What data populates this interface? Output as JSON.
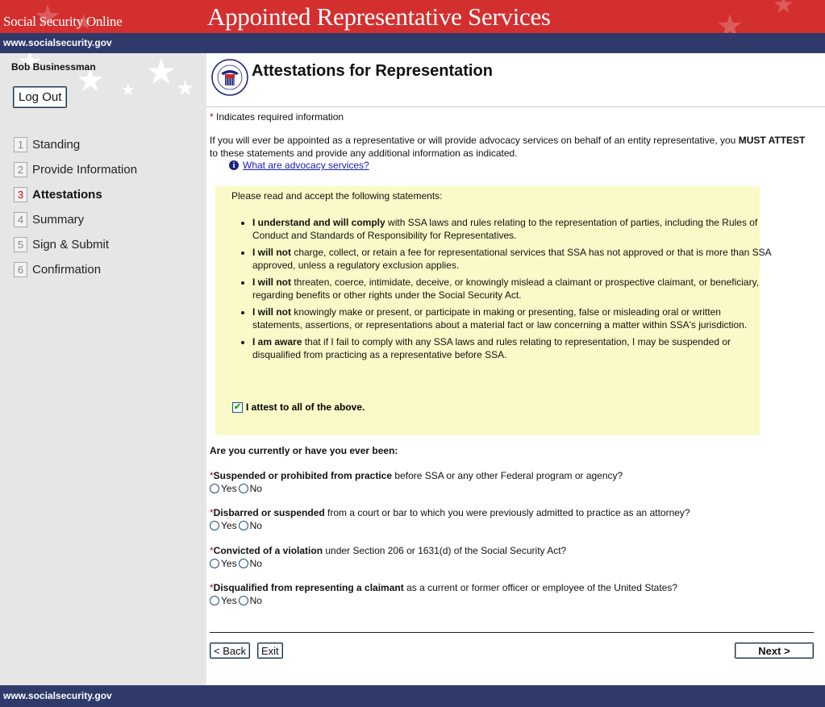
{
  "banner": {
    "brand": "Social Security Online",
    "title": "Appointed Representative Services"
  },
  "urlbar": {
    "url": "www.socialsecurity.gov"
  },
  "sidebar": {
    "user_name": "Bob Businessman",
    "logout_label": "Log Out",
    "steps": [
      {
        "num": "1",
        "label": "Standing"
      },
      {
        "num": "2",
        "label": "Provide Information"
      },
      {
        "num": "3",
        "label": "Attestations"
      },
      {
        "num": "4",
        "label": "Summary"
      },
      {
        "num": "5",
        "label": "Sign & Submit"
      },
      {
        "num": "6",
        "label": "Confirmation"
      }
    ],
    "active_step": "Attestations"
  },
  "page": {
    "title": "Attestations for Representation",
    "seal_text": "SOCIAL SECURITY ADMINISTRATION USA",
    "required_marker": "*",
    "required_note": "Indicates required information",
    "intro_text": "If you will ever be appointed as a representative or will provide advocacy services on behalf of an entity representative, you ",
    "intro_bold": "MUST ATTEST",
    "intro_text_end": " to these statements and provide any additional information as indicated.",
    "help_link": "What are advocacy services?"
  },
  "attestations": {
    "lead": "Please read and accept the following statements:",
    "statements": [
      {
        "bold": "I understand and will comply",
        "text": " with SSA laws and rules relating to the representation of parties, including the Rules of Conduct and Standards of Responsibility for Representatives."
      },
      {
        "bold": "I will not",
        "text": " charge, collect, or retain a fee for representational services that SSA has not approved or that is more than SSA approved, unless a regulatory exclusion applies."
      },
      {
        "bold": "I will not",
        "text": " threaten, coerce, intimidate, deceive, or knowingly mislead a claimant or prospective claimant, or beneficiary, regarding benefits or other rights under the Social Security Act."
      },
      {
        "bold": "I will not",
        "text": " knowingly make or present, or participate in making or presenting, false or misleading oral or written statements, assertions, or representations about a material fact or law concerning a matter within SSA's jurisdiction."
      },
      {
        "bold": "I am aware",
        "text": " that if I fail to comply with any SSA laws and rules relating to representation, I may be suspended or disqualified from practicing as a representative before SSA."
      }
    ],
    "attest_label": "I attest to all of the above.",
    "attest_checked": true
  },
  "questions": {
    "heading": "Are you currently or have you ever been:",
    "yes_label": "Yes",
    "no_label": "No",
    "items": [
      {
        "bold": "Suspended or prohibited from practice",
        "text": " before SSA or any other Federal program or agency?"
      },
      {
        "bold": "Disbarred or suspended",
        "text": " from a court or bar to which you were previously admitted to practice as an attorney?"
      },
      {
        "bold": "Convicted of a violation",
        "text": " under Section 206 or 1631(d) of the Social Security Act?"
      },
      {
        "bold": "Disqualified from representing a claimant",
        "text": " as a current or former officer or employee of the United States?"
      }
    ]
  },
  "buttons": {
    "back": "< Back",
    "exit": "Exit",
    "next": "Next >"
  },
  "footer": {
    "url": "www.socialsecurity.gov"
  },
  "colors": {
    "banner_red": "#d32f2f",
    "navy": "#2f3a6b",
    "attest_bg": "#fafac8",
    "sidebar_bg": "#e6e6e6",
    "required_red": "#cc0000",
    "link_blue": "#1a1ab4"
  }
}
